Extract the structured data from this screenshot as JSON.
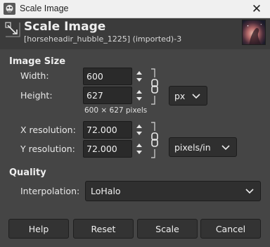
{
  "window": {
    "title": "Scale Image",
    "close_glyph": "✕",
    "icon": "gimp-app-icon"
  },
  "header": {
    "title": "Scale Image",
    "subtitle": "[horseheadir_hubble_1225] (imported)-3",
    "icon": "scale-image-icon"
  },
  "image_size": {
    "section_label": "Image Size",
    "width_label": "Width:",
    "width_value": "600",
    "height_label": "Height:",
    "height_value": "627",
    "unit": "px",
    "pixels_note": "600 × 627 pixels",
    "x_res_label": "X resolution:",
    "x_res_value": "72.000",
    "y_res_label": "Y resolution:",
    "y_res_value": "72.000",
    "res_unit": "pixels/in",
    "chain_linked": true
  },
  "quality": {
    "section_label": "Quality",
    "interpolation_label": "Interpolation:",
    "interpolation_value": "LoHalo"
  },
  "buttons": {
    "help": "Help",
    "reset": "Reset",
    "scale": "Scale",
    "cancel": "Cancel"
  },
  "colors": {
    "dialog_bg": "#454545",
    "header_bg": "#3b3b3b",
    "entry_bg": "#2a2a2a",
    "titlebar_bg": "#f0f0f0"
  }
}
